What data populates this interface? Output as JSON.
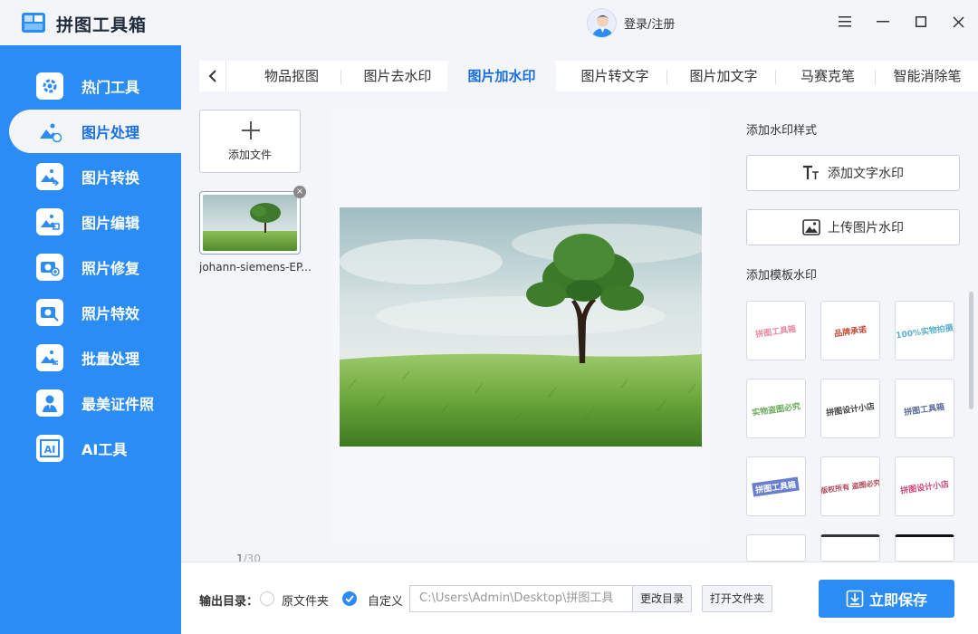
{
  "app": {
    "title": "拼图工具箱",
    "login_text": "登录/注册"
  },
  "sidebar": {
    "items": [
      {
        "label": "热门工具",
        "icon": "gear-icon"
      },
      {
        "label": "图片处理",
        "icon": "image-edit-icon"
      },
      {
        "label": "图片转换",
        "icon": "image-convert-icon"
      },
      {
        "label": "图片编辑",
        "icon": "image-edit-icon"
      },
      {
        "label": "照片修复",
        "icon": "camera-plus-icon"
      },
      {
        "label": "照片特效",
        "icon": "camera-magic-icon"
      },
      {
        "label": "批量处理",
        "icon": "image-batch-icon"
      },
      {
        "label": "最美证件照",
        "icon": "id-photo-icon"
      },
      {
        "label": "AI工具",
        "icon": "ai-icon"
      }
    ],
    "active_index": 1
  },
  "tabs": {
    "items": [
      "物品抠图",
      "图片去水印",
      "图片加水印",
      "图片转文字",
      "图片加文字",
      "马赛克笔",
      "智能消除笔"
    ],
    "active_index": 2
  },
  "files": {
    "add_label": "添加文件",
    "items": [
      {
        "name": "johann-siemens-EP..."
      }
    ],
    "current": "1",
    "total": "/30"
  },
  "watermark_panel": {
    "style_title": "添加水印样式",
    "text_button": "添加文字水印",
    "image_button": "上传图片水印",
    "template_title": "添加模板水印",
    "templates": [
      "拼图工具箱",
      "品牌承诺",
      "100%实物拍摄",
      "实物盗图必究",
      "拼图设计小店",
      "拼图工具箱",
      "拼图工具箱",
      "版权所有 盗图必究",
      "拼图设计小店"
    ]
  },
  "bottom_bar": {
    "output_label": "输出目录：",
    "option_original": "原文件夹",
    "option_custom": "自定义",
    "selected": "custom",
    "path_value": "C:\\Users\\Admin\\Desktop\\拼图工具",
    "change_dir_button": "更改目录",
    "open_folder_button": "打开文件夹",
    "save_button": "立即保存"
  },
  "colors": {
    "accent": "#2b8cf5",
    "active_text": "#1a6fe0"
  }
}
